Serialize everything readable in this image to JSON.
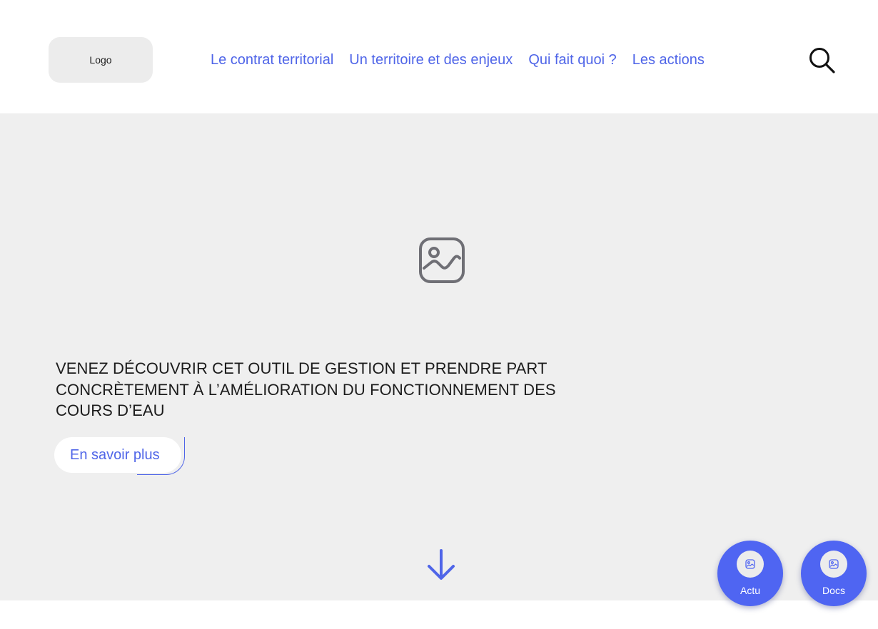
{
  "header": {
    "logo": "Logo",
    "nav": [
      {
        "label": "Le contrat territorial"
      },
      {
        "label": "Un territoire et des enjeux"
      },
      {
        "label": "Qui fait quoi ?"
      },
      {
        "label": "Les actions"
      }
    ],
    "search_icon": "search-icon"
  },
  "hero": {
    "image_icon": "image-placeholder-icon",
    "headline_lines": [
      "VENEZ DÉCOUVRIR CET OUTIL DE GESTION ET PRENDRE PART",
      "CONCRÈTEMENT À L’AMÉLIORATION DU FONCTIONNEMENT DES",
      "COURS D’EAU"
    ],
    "cta_label": "En savoir plus",
    "scroll_icon": "arrow-down-icon"
  },
  "floating_buttons": [
    {
      "label": "Actu",
      "icon": "image-icon"
    },
    {
      "label": "Docs",
      "icon": "image-icon"
    }
  ],
  "colors": {
    "accent": "#4f65e8",
    "hero_background": "#efefef",
    "logo_background": "#ececec",
    "fab_background": "#4f65f2"
  }
}
